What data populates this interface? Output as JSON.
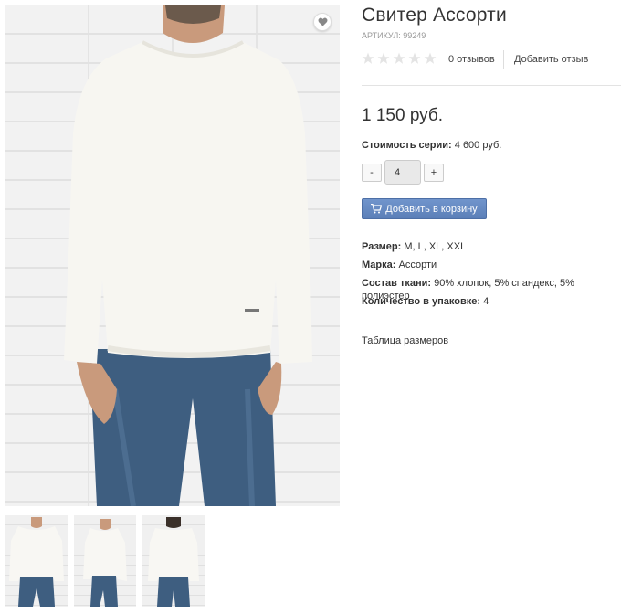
{
  "product": {
    "title": "Свитер Ассорти",
    "sku_label": "АРТИКУЛ:",
    "sku_value": "99249",
    "rating_value": 0,
    "rating_max": 5,
    "reviews_count": "0 отзывов",
    "add_review": "Добавить отзыв",
    "price": "1 150 руб.",
    "series_label": "Стоимость серии:",
    "series_value": "4 600 руб.",
    "qty_minus": "-",
    "qty_value": "4",
    "qty_plus": "+",
    "add_to_cart": "Добавить в корзину",
    "specs": [
      {
        "label": "Размер:",
        "value": "M, L, XL, XXL"
      },
      {
        "label": "Марка:",
        "value": "Ассорти"
      },
      {
        "label": "Состав ткани:",
        "value": "90% хлопок, 5% спандекс, 5% полиэстер"
      },
      {
        "label": "Количество в упаковке:",
        "value": "4"
      }
    ],
    "size_table_link": "Таблица размеров"
  },
  "icons": {
    "favorite": "heart-icon",
    "cart": "cart-icon",
    "star": "star-icon"
  },
  "colors": {
    "button": "#6a8ec8",
    "star_empty": "#e4e4e4",
    "sweater": "#f7f6f1",
    "jeans": "#3e5e80"
  }
}
